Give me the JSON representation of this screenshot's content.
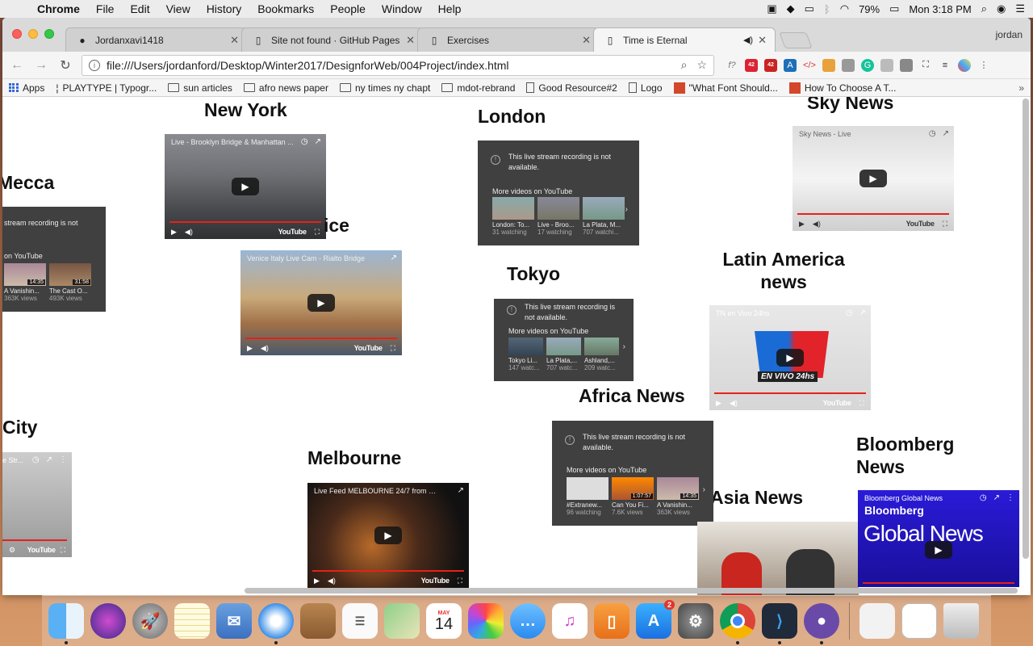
{
  "menubar": {
    "app": "Chrome",
    "items": [
      "File",
      "Edit",
      "View",
      "History",
      "Bookmarks",
      "People",
      "Window",
      "Help"
    ],
    "battery": "79%",
    "clock": "Mon 3:18 PM"
  },
  "tabs": [
    {
      "title": "Jordanxavi1418",
      "favicon": "github-icon"
    },
    {
      "title": "Site not found · GitHub Pages",
      "favicon": "page-icon"
    },
    {
      "title": "Exercises",
      "favicon": "page-icon"
    },
    {
      "title": "Time is Eternal",
      "favicon": "page-icon",
      "active": true
    }
  ],
  "profile": "jordan",
  "omnibox": {
    "url": "file:///Users/jordanford/Desktop/Winter2017/DesignforWeb/004Project/index.html"
  },
  "extensions": {
    "badge1": "42",
    "badge2": "42"
  },
  "bookmarks": [
    {
      "label": "Apps",
      "icon": "apps-grid-icon"
    },
    {
      "label": "PLAYTYPE | Typogr...",
      "icon": "playtype-icon"
    },
    {
      "label": "sun articles",
      "icon": "folder-icon"
    },
    {
      "label": "afro news paper",
      "icon": "folder-icon"
    },
    {
      "label": "ny times ny chapt",
      "icon": "folder-icon"
    },
    {
      "label": "mdot-rebrand",
      "icon": "folder-icon"
    },
    {
      "label": "Good Resource#2",
      "icon": "doc-icon"
    },
    {
      "label": "Logo",
      "icon": "doc-icon"
    },
    {
      "label": "\"What Font Should...",
      "icon": "smashing-icon"
    },
    {
      "label": "How To Choose A T...",
      "icon": "smashing-icon"
    }
  ],
  "cities": {
    "new_york": "New York",
    "london": "London",
    "sky_news": "Sky News",
    "mecca": "Mecca",
    "venice": "ice",
    "tokyo": "Tokyo",
    "latin_america": "Latin America news",
    "africa": "Africa News",
    "city": "City",
    "melbourne": "Melbourne",
    "bloomberg": "Bloomberg News",
    "asia": "Asia News"
  },
  "videos": {
    "new_york": {
      "title": "Live - Brooklyn Bridge & Manhattan ..."
    },
    "venice": {
      "title": "Venice Italy Live Cam - Rialto Bridge"
    },
    "sky": {
      "title": "Sky News - Live"
    },
    "tn": {
      "title": "TN en Vivo 24hs"
    },
    "melbourne": {
      "title": "Live Feed MELBOURNE 24/7 from P..."
    },
    "bloomberg": {
      "title": "Bloomberg Global News"
    },
    "city": {
      "title": "e Str..."
    }
  },
  "unavailable": {
    "message": "This live stream recording is not available.",
    "more": "More videos on YouTube",
    "london_thumbs": [
      {
        "t1": "London: To...",
        "t2": "31 watching"
      },
      {
        "t1": "Live - Broo...",
        "t2": "17 watching"
      },
      {
        "t1": "La Plata, M...",
        "t2": "707 watchi..."
      }
    ],
    "tokyo_thumbs": [
      {
        "t1": "Tokyo Li...",
        "t2": "147 watc..."
      },
      {
        "t1": "La Plata,...",
        "t2": "707 watc..."
      },
      {
        "t1": "Ashland,...",
        "t2": "209 watc..."
      }
    ],
    "africa_thumbs": [
      {
        "t1": "#Extranew...",
        "t2": "96 watching",
        "dur": ""
      },
      {
        "t1": "Can You Fi...",
        "t2": "7.6K views",
        "dur": "1:07:57"
      },
      {
        "t1": "A Vanishin...",
        "t2": "363K views",
        "dur": "14:35"
      }
    ],
    "mecca_msg": "stream recording is not",
    "mecca_more": "on YouTube",
    "mecca_thumbs": [
      {
        "t1": "A Vanishin...",
        "t2": "363K views",
        "dur": "14:35"
      },
      {
        "t1": "The Cast O...",
        "t2": "493K views",
        "dur": "31:58"
      }
    ]
  },
  "video_chrome": {
    "youtube": "YouTube"
  },
  "bloomberg_overlay": {
    "brand": "Bloomberg",
    "headline": "Global News"
  },
  "tn_overlay": {
    "text": "EN VIVO 24hs"
  },
  "dock": {
    "apps": [
      "Finder",
      "Siri",
      "Launchpad",
      "Notes",
      "Mail",
      "Safari",
      "Contacts",
      "Reminders",
      "Maps",
      "Calendar",
      "Photos",
      "Messages",
      "iTunes",
      "iBooks",
      "App Store",
      "System Preferences",
      "Chrome",
      "VS Code",
      "GitHub Desktop"
    ],
    "calendar_month": "MAY",
    "calendar_day": "14",
    "appstore_badge": "2"
  }
}
